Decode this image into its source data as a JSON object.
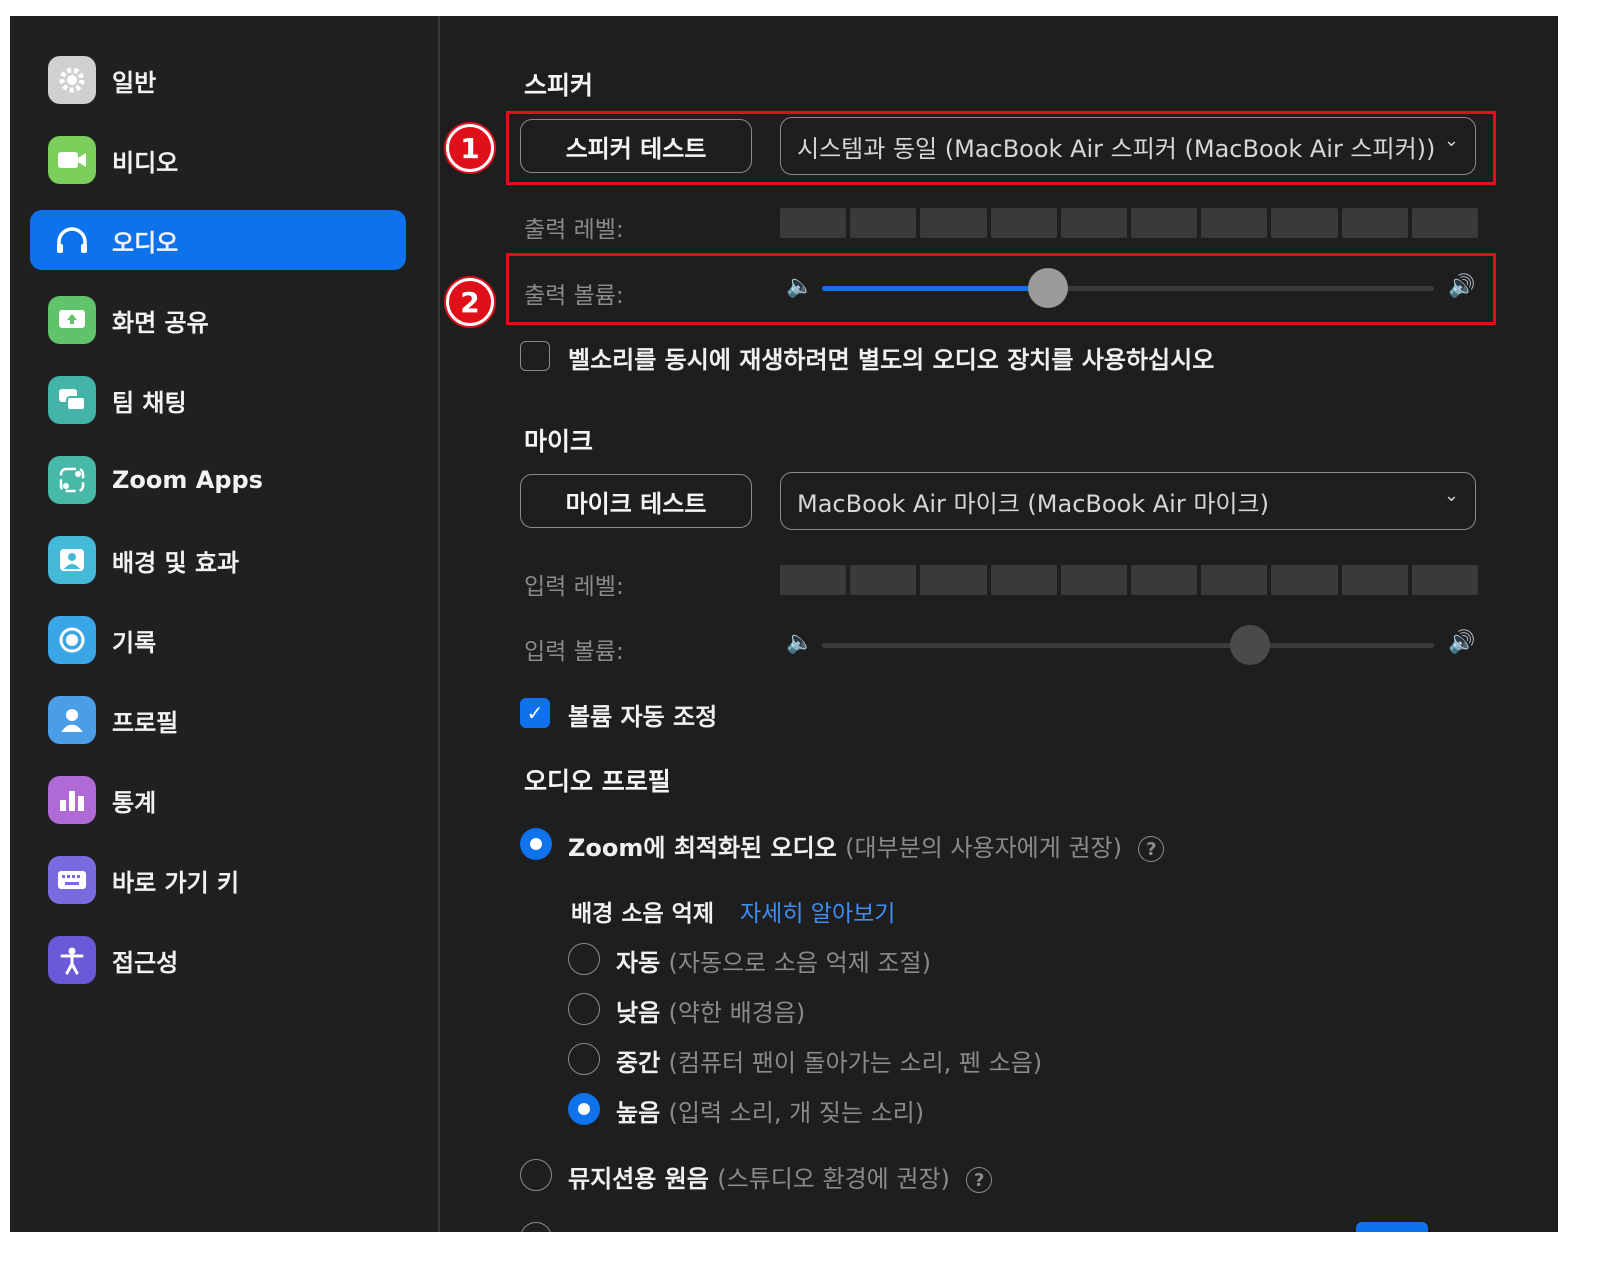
{
  "sidebar": {
    "items": [
      {
        "label": "일반",
        "icon": "gear-icon",
        "color": "#d0d0d0"
      },
      {
        "label": "비디오",
        "icon": "video-camera-icon",
        "color": "#7ccf5a"
      },
      {
        "label": "오디오",
        "icon": "headphones-icon",
        "color": "#0e72ed",
        "active": true
      },
      {
        "label": "화면 공유",
        "icon": "screen-share-icon",
        "color": "#5fc36a"
      },
      {
        "label": "팀 채팅",
        "icon": "chat-bubbles-icon",
        "color": "#45b4a8"
      },
      {
        "label": "Zoom Apps",
        "icon": "apps-icon",
        "color": "#48b8a8"
      },
      {
        "label": "배경 및 효과",
        "icon": "background-person-icon",
        "color": "#45b9d8"
      },
      {
        "label": "기록",
        "icon": "record-icon",
        "color": "#3aa6e8"
      },
      {
        "label": "프로필",
        "icon": "profile-icon",
        "color": "#4a9ee8"
      },
      {
        "label": "통계",
        "icon": "bar-chart-icon",
        "color": "#b06ad6"
      },
      {
        "label": "바로 가기 키",
        "icon": "keyboard-icon",
        "color": "#7a6ae0"
      },
      {
        "label": "접근성",
        "icon": "accessibility-icon",
        "color": "#6a5ad8"
      }
    ]
  },
  "speaker": {
    "heading": "스피커",
    "test_button": "스피커 테스트",
    "device": "시스템과 동일 (MacBook Air 스피커 (MacBook Air 스피커))",
    "output_level_label": "출력 레벨:",
    "output_volume_label": "출력 볼륨:",
    "output_volume_value": 0.37,
    "separate_device_label": "벨소리를 동시에 재생하려면 별도의 오디오 장치를 사용하십시오",
    "separate_device_checked": false
  },
  "microphone": {
    "heading": "마이크",
    "test_button": "마이크 테스트",
    "device": "MacBook Air 마이크 (MacBook Air 마이크)",
    "input_level_label": "입력 레벨:",
    "input_volume_label": "입력 볼륨:",
    "input_volume_value": 0.7,
    "auto_adjust_label": "볼륨 자동 조정",
    "auto_adjust_checked": true
  },
  "audio_profile": {
    "heading": "오디오 프로필",
    "zoom_optimized": {
      "label": "Zoom에 최적화된 오디오",
      "note": "(대부분의 사용자에게 권장)",
      "selected": true
    },
    "noise_suppression_label": "배경 소음 억제",
    "learn_more": "자세히 알아보기",
    "levels": [
      {
        "label": "자동",
        "note": "(자동으로 소음 억제 조절)",
        "selected": false
      },
      {
        "label": "낮음",
        "note": "(약한 배경음)",
        "selected": false
      },
      {
        "label": "중간",
        "note": "(컴퓨터 팬이 돌아가는 소리, 펜 소음)",
        "selected": false
      },
      {
        "label": "높음",
        "note": "(입력 소리, 개 짖는 소리)",
        "selected": true
      }
    ],
    "musician": {
      "label": "뮤지션용 원음",
      "note": "(스튜디오 환경에 권장)",
      "selected": false
    }
  },
  "annotations": {
    "badge1": "1",
    "badge2": "2",
    "highlight_color": "#e0101b"
  },
  "icons": {
    "chevron": "chevron-down-icon",
    "help": "?",
    "speaker_low": "🔈",
    "speaker_high": "🔊"
  }
}
